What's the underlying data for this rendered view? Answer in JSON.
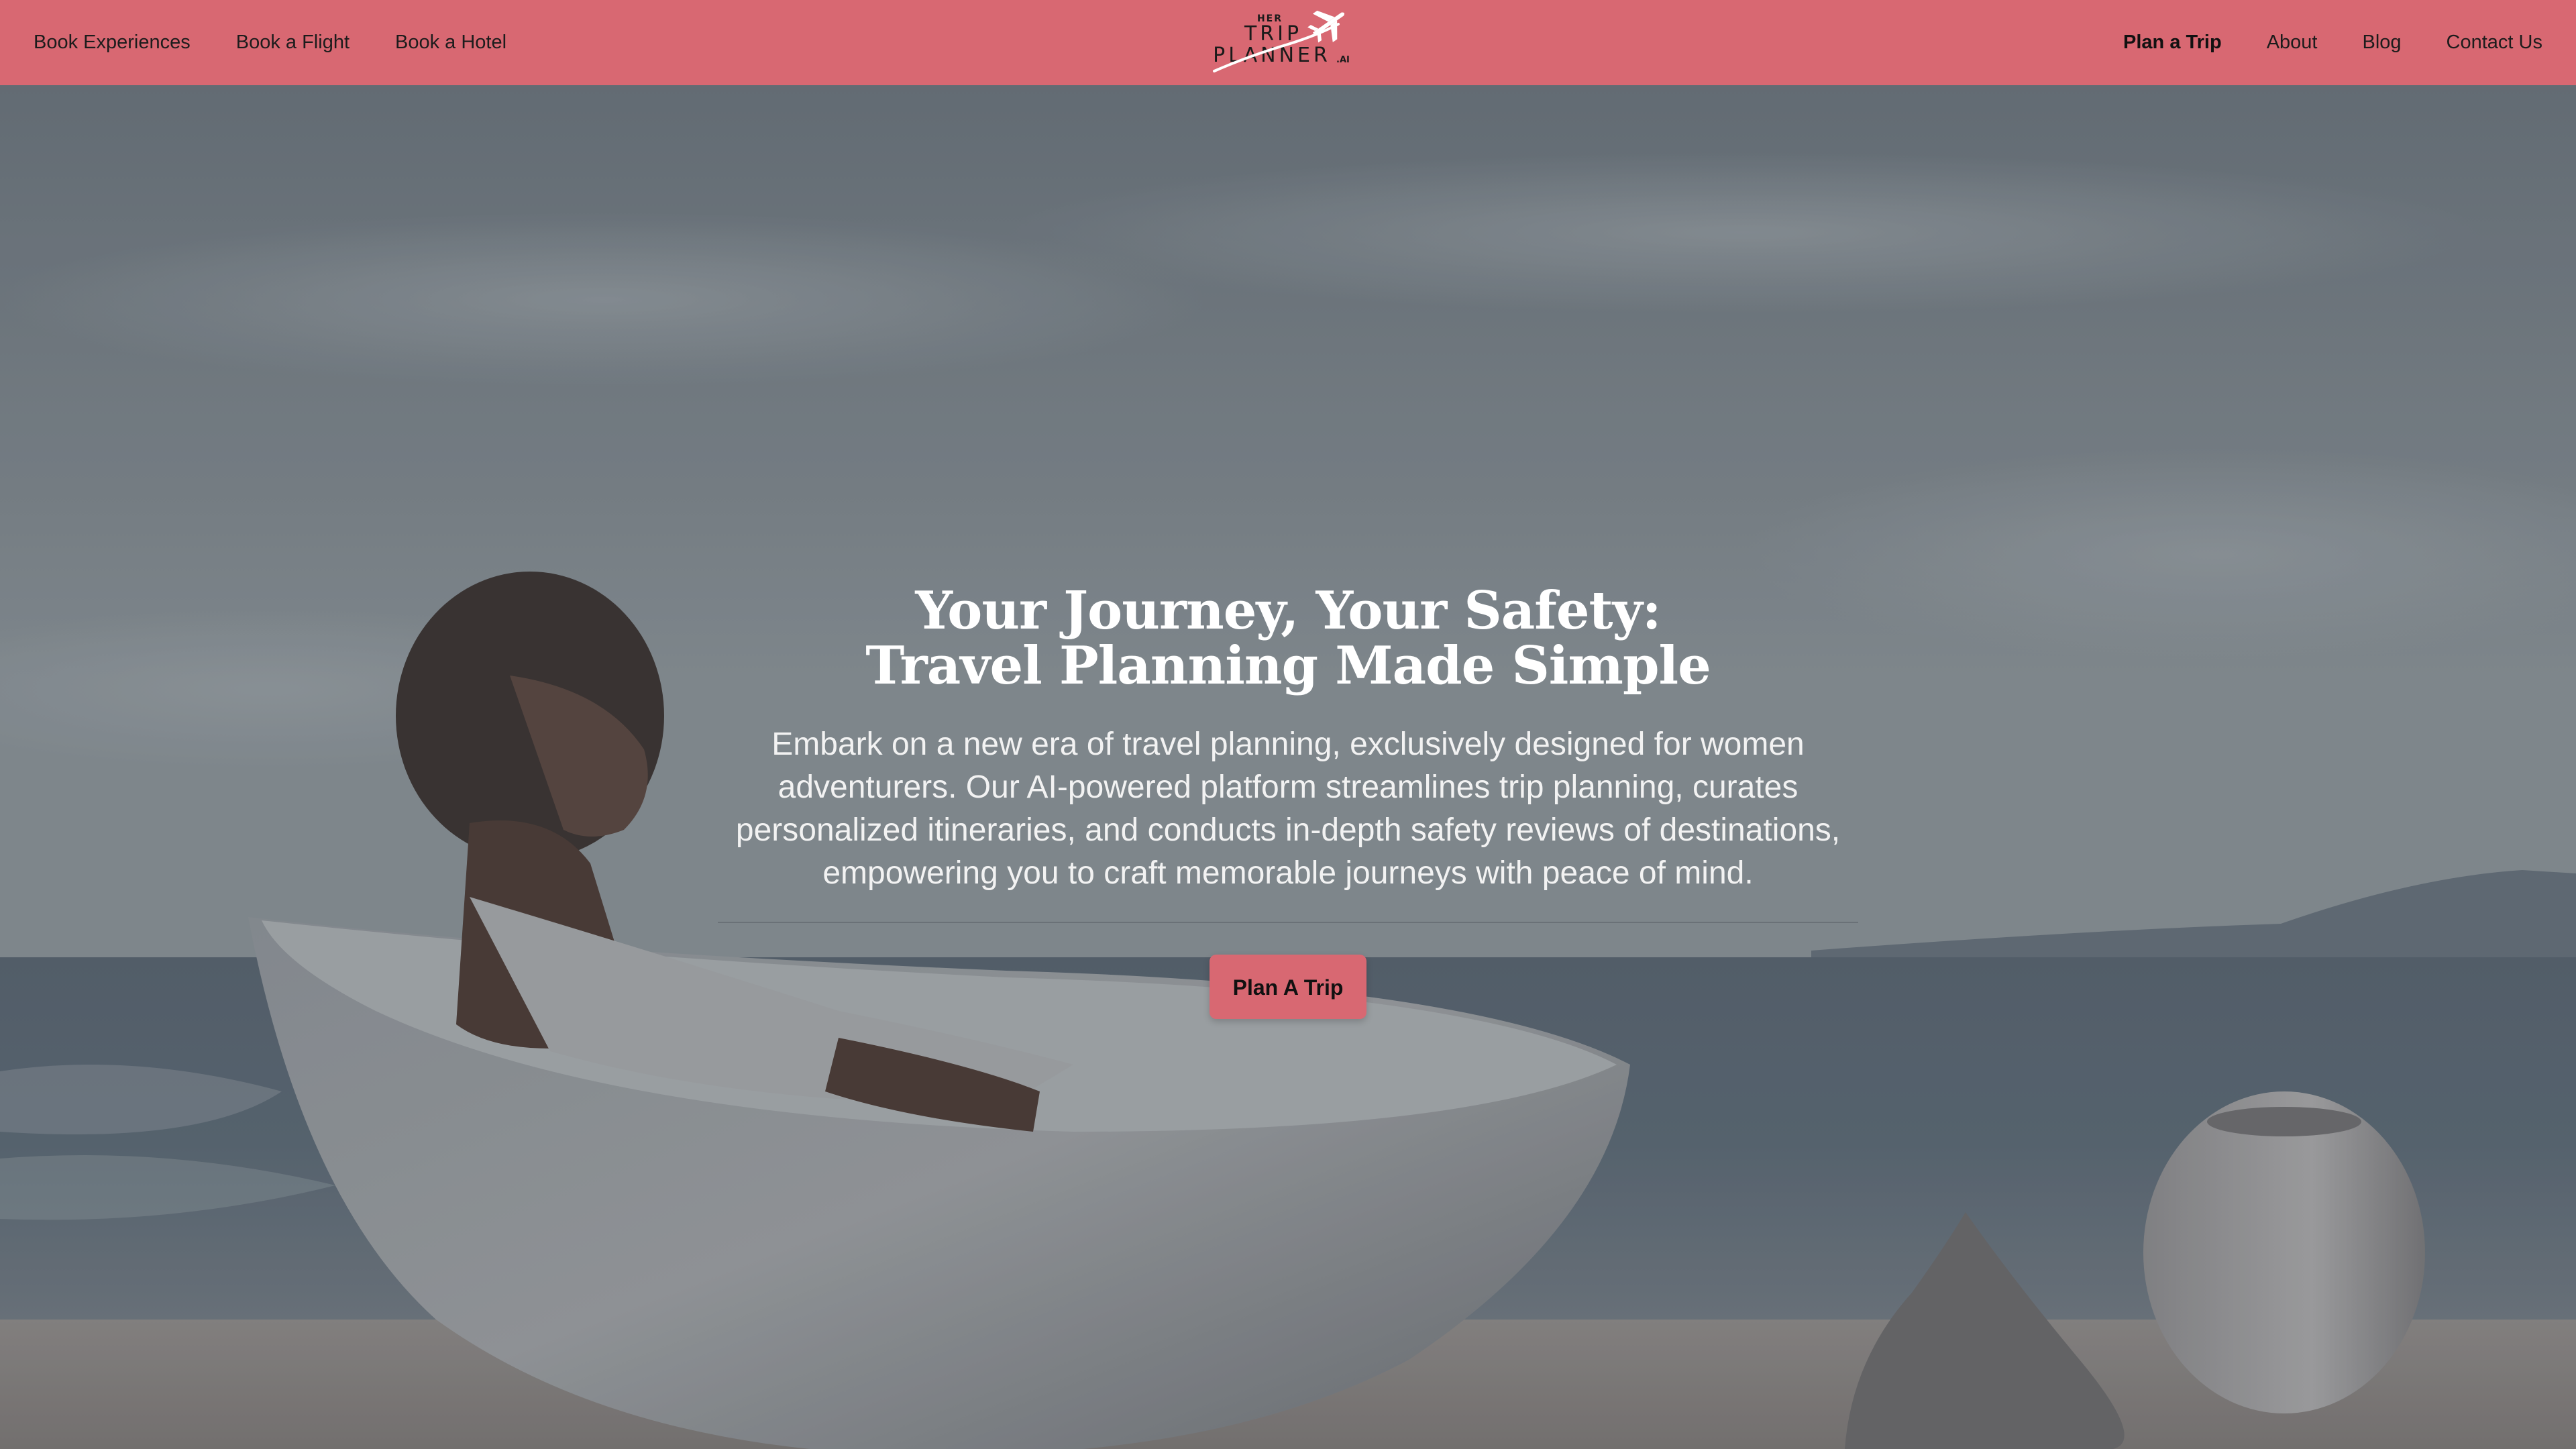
{
  "nav": {
    "left": [
      {
        "label": "Book Experiences"
      },
      {
        "label": "Book a Flight"
      },
      {
        "label": "Book a Hotel"
      }
    ],
    "right": [
      {
        "label": "Plan a Trip"
      },
      {
        "label": "About"
      },
      {
        "label": "Blog"
      },
      {
        "label": "Contact Us"
      }
    ]
  },
  "logo": {
    "line1": "HER",
    "line2": "TRIP",
    "line3": "PLANNER",
    "suffix": ".AI",
    "icon": "airplane-icon"
  },
  "hero": {
    "title_line1": "Your Journey, Your Safety:",
    "title_line2": "Travel Planning Made Simple",
    "subtitle": "Embark on a new era of travel planning, exclusively designed for women adventurers. Our AI-powered platform streamlines trip planning, curates personalized itineraries, and conducts in-depth safety reviews of destinations, empowering you to craft memorable journeys with peace of mind.",
    "cta_label": "Plan A Trip"
  },
  "colors": {
    "brand": "#d86872",
    "hero_text": "#ffffff"
  }
}
